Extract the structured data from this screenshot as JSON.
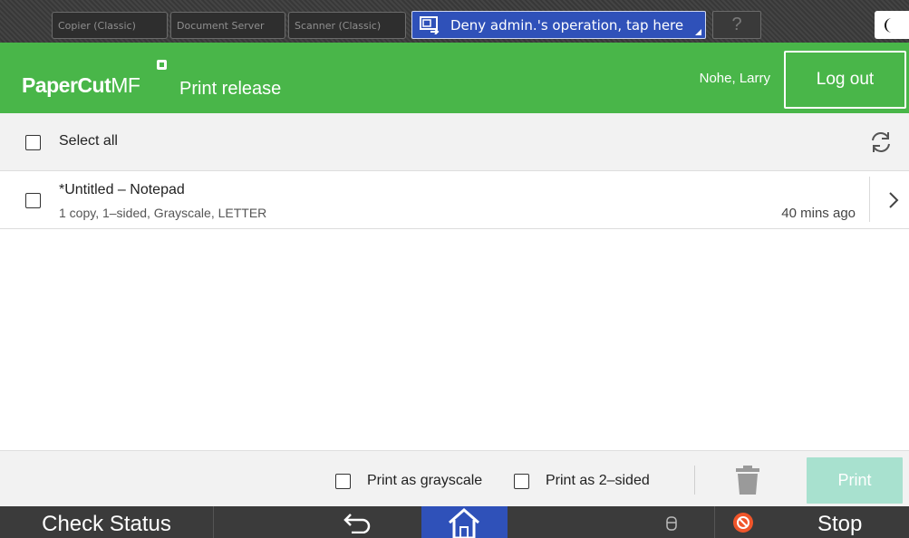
{
  "device_bar": {
    "tabs": [
      {
        "label": "Copier (Classic)"
      },
      {
        "label": "Document Server"
      },
      {
        "label": "Scanner (Classic)"
      }
    ],
    "deny_button_label": "Deny admin.'s operation, tap here",
    "help_label": "?"
  },
  "header": {
    "logo_text": "PaperCut",
    "logo_suffix": "MF",
    "page_title": "Print release",
    "user_name": "Nohe, Larry",
    "logout_label": "Log out",
    "background_color": "#49b649"
  },
  "list": {
    "select_all_label": "Select all",
    "jobs": [
      {
        "title": "*Untitled – Notepad",
        "details": "1 copy, 1–sided, Grayscale, LETTER",
        "time": "40 mins ago"
      }
    ]
  },
  "actions": {
    "grayscale_label": "Print as grayscale",
    "two_sided_label": "Print as 2–sided",
    "print_label": "Print"
  },
  "footer": {
    "check_status_label": "Check Status",
    "stop_label": "Stop"
  }
}
